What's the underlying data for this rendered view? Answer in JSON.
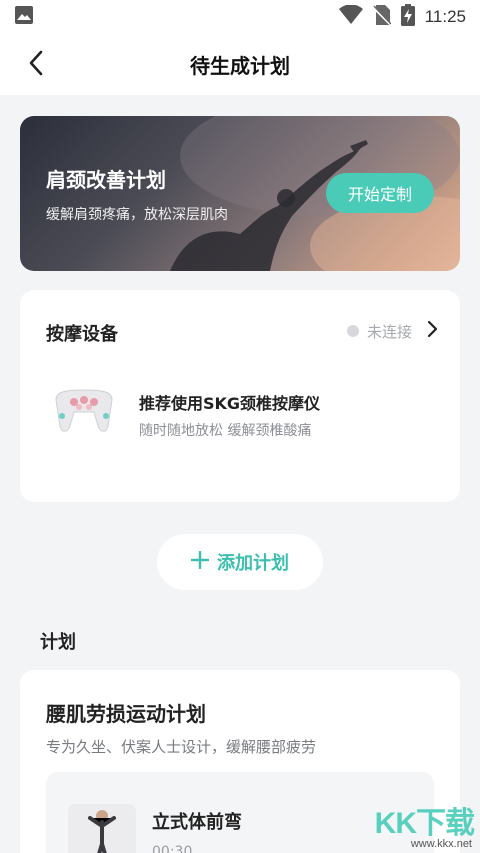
{
  "status_bar": {
    "time": "11:25",
    "icons": [
      "image-icon",
      "wifi-icon",
      "no-sim-icon",
      "battery-charging-icon"
    ]
  },
  "app_bar": {
    "title": "待生成计划",
    "back_icon": "chevron-left-icon"
  },
  "banner": {
    "title": "肩颈改善计划",
    "subtitle": "缓解肩颈疼痛，放松深层肌肉",
    "button_label": "开始定制",
    "accent": "#49cbb8"
  },
  "device_card": {
    "title": "按摩设备",
    "status": "未连接",
    "status_icon": "chevron-right-icon",
    "device_name": "推荐使用SKG颈椎按摩仪",
    "device_desc": "随时随地放松 缓解颈椎酸痛"
  },
  "add_plan": {
    "icon": "plus-icon",
    "label": "添加计划",
    "color": "#3cbfae"
  },
  "plans": {
    "section_title": "计划",
    "card": {
      "title": "腰肌劳损运动计划",
      "desc": "专为久坐、伏案人士设计，缓解腰部疲劳",
      "exercise": {
        "name": "立式体前弯",
        "time": "00:30"
      }
    }
  },
  "watermark": {
    "logo": "KK下载",
    "url": "www.kkx.net"
  }
}
